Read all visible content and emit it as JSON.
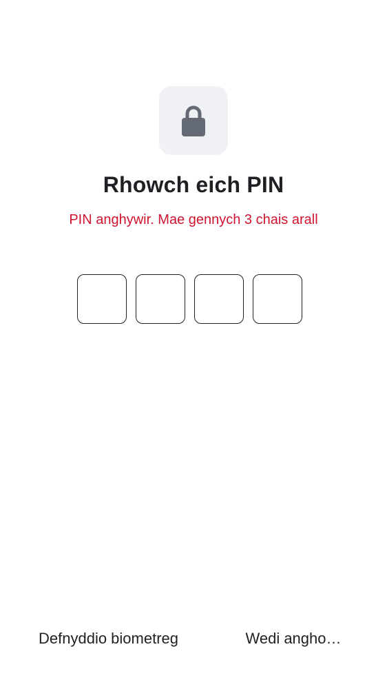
{
  "header": {
    "icon": "lock-icon",
    "title": "Rhowch eich PIN",
    "error": "PIN anghywir. Mae gennych 3 chais arall"
  },
  "pin": {
    "length": 4,
    "entered": 0
  },
  "footer": {
    "biometric_label": "Defnyddio biometreg",
    "forgot_label": "Wedi angho…"
  },
  "colors": {
    "error": "#d0142f",
    "icon": "#636a74",
    "tile": "#eff1f4",
    "text": "#1f2024"
  }
}
